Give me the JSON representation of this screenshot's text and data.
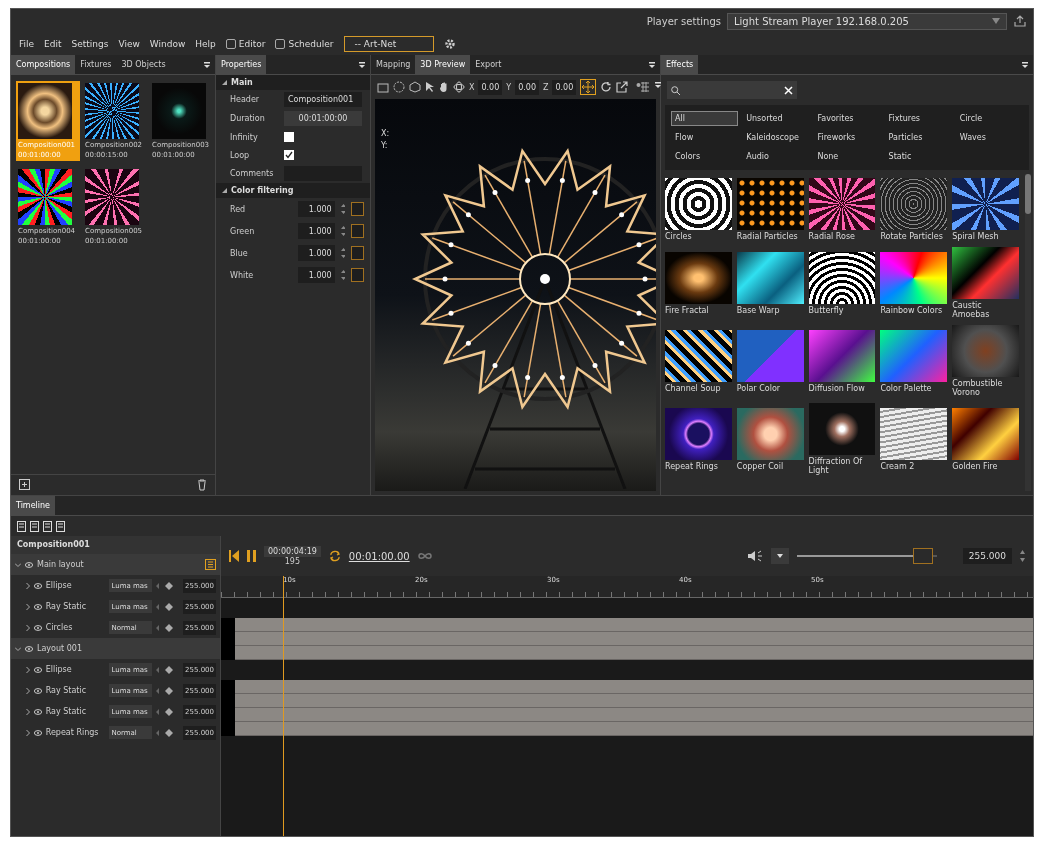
{
  "player_settings": {
    "label": "Player settings",
    "value": "Light Stream Player 192.168.0.205"
  },
  "menu": [
    "File",
    "Edit",
    "Settings",
    "View",
    "Window",
    "Help"
  ],
  "mode_toggles": [
    {
      "label": "Editor",
      "checked": false
    },
    {
      "label": "Scheduler",
      "checked": false
    }
  ],
  "protocol": {
    "value": "-- Art-Net"
  },
  "compositions_panel": {
    "tabs": [
      {
        "label": "Compositions",
        "selected": true
      },
      {
        "label": "Fixtures",
        "selected": false
      },
      {
        "label": "3D Objects",
        "selected": false
      }
    ],
    "items": [
      {
        "name": "Composition001",
        "duration": "00:01:00:00",
        "selected": true
      },
      {
        "name": "Composition002",
        "duration": "00:00:15:00",
        "selected": false
      },
      {
        "name": "Composition003",
        "duration": "00:01:00:00",
        "selected": false
      },
      {
        "name": "Composition004",
        "duration": "00:01:00:00",
        "selected": false
      },
      {
        "name": "Composition005",
        "duration": "00:01:00:00",
        "selected": false
      }
    ]
  },
  "properties": {
    "tab": "Properties",
    "sections": [
      {
        "title": "Main",
        "rows": [
          {
            "kind": "text",
            "label": "Header",
            "value": "Composition001"
          },
          {
            "kind": "button",
            "label": "Duration",
            "value": "00:01:00:00"
          },
          {
            "kind": "checkbox",
            "label": "Infinity",
            "checked": false
          },
          {
            "kind": "checkbox",
            "label": "Loop",
            "checked": true
          },
          {
            "kind": "text",
            "label": "Comments"
          }
        ]
      },
      {
        "title": "Color filtering",
        "rows": [
          {
            "kind": "number",
            "label": "Red",
            "value": "1.000"
          },
          {
            "kind": "number",
            "label": "Green",
            "value": "1.000"
          },
          {
            "kind": "number",
            "label": "Blue",
            "value": "1.000"
          },
          {
            "kind": "number",
            "label": "White",
            "value": "1.000"
          }
        ]
      }
    ]
  },
  "preview": {
    "tabs": [
      {
        "label": "Mapping",
        "selected": false
      },
      {
        "label": "3D Preview",
        "selected": true
      },
      {
        "label": "Export",
        "selected": false
      }
    ],
    "coordinates": [
      {
        "axis": "X",
        "value": "0.00"
      },
      {
        "axis": "Y",
        "value": "0.00"
      },
      {
        "axis": "Z",
        "value": "0.00"
      }
    ],
    "axis_labels": [
      "X:",
      "Y:"
    ]
  },
  "effects": {
    "tab": "Effects",
    "categories": [
      {
        "label": "All",
        "selected": true
      },
      {
        "label": "Unsorted",
        "selected": false
      },
      {
        "label": "Favorites",
        "selected": false
      },
      {
        "label": "Fixtures",
        "selected": false
      },
      {
        "label": "Circle",
        "selected": false
      },
      {
        "label": "Flow",
        "selected": false
      },
      {
        "label": "Kaleidoscope",
        "selected": false
      },
      {
        "label": "Fireworks",
        "selected": false
      },
      {
        "label": "Particles",
        "selected": false
      },
      {
        "label": "Waves",
        "selected": false
      },
      {
        "label": "Colors",
        "selected": false
      },
      {
        "label": "Audio",
        "selected": false
      },
      {
        "label": "None",
        "selected": false
      },
      {
        "label": "Static",
        "selected": false
      }
    ],
    "items": [
      "Circles",
      "Radial Particles",
      "Radial Rose",
      "Rotate Particles",
      "Spiral Mesh",
      "Fire Fractal",
      "Base Warp",
      "Butterfly",
      "Rainbow Colors",
      "Caustic Amoebas",
      "Channel Soup",
      "Polar Color",
      "Diffusion Flow",
      "Color Palette",
      "Combustible Vorono",
      "Repeat Rings",
      "Copper Coil",
      "Diffraction Of Light",
      "Cream 2",
      "Golden Fire"
    ]
  },
  "timeline": {
    "tab": "Timeline",
    "composition": "Composition001",
    "layers": [
      {
        "name": "Main layout",
        "expanded": true,
        "children": [
          {
            "name": "Ellipse",
            "blend": "Luma mas",
            "opacity": "255.000"
          },
          {
            "name": "Ray Static",
            "blend": "Luma mas",
            "opacity": "255.000"
          },
          {
            "name": "Circles",
            "blend": "Normal",
            "opacity": "255.000"
          }
        ]
      },
      {
        "name": "Layout 001",
        "expanded": true,
        "children": [
          {
            "name": "Ellipse",
            "blend": "Luma mas",
            "opacity": "255.000"
          },
          {
            "name": "Ray Static",
            "blend": "Luma mas",
            "opacity": "255.000"
          },
          {
            "name": "Ray Static",
            "blend": "Luma mas",
            "opacity": "255.000"
          },
          {
            "name": "Repeat Rings",
            "blend": "Normal",
            "opacity": "255.000"
          }
        ]
      }
    ],
    "current_time": "00:00:04:19",
    "frame": "195",
    "duration": "00:01:00.00",
    "ruler": [
      "10s",
      "20s",
      "30s",
      "40s",
      "50s"
    ],
    "opacity": {
      "level": 0.9,
      "value": "255.000"
    }
  }
}
